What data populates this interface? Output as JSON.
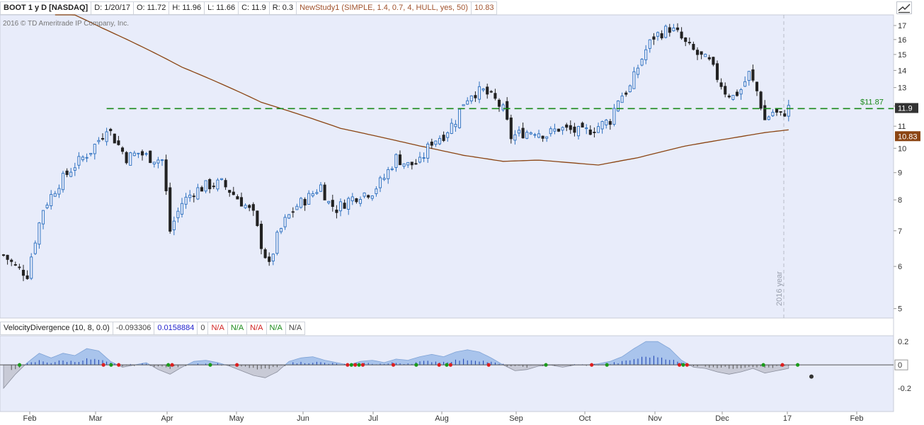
{
  "header": {
    "symbol": "BOOT 1 y D [NASDAQ]",
    "date": "D: 1/20/17",
    "open": "O: 11.72",
    "high": "H: 11.96",
    "low": "L: 11.66",
    "close": "C: 11.9",
    "range": "R: 0.3",
    "study": "NewStudy1 (SIMPLE, 1.4, 0.7, 4, HULL, yes, 50)",
    "study_value": "10.83"
  },
  "copyright": "2016 © TD Ameritrade IP Company, Inc.",
  "lower": {
    "name": "VelocityDivergence (10, 8, 0.0)",
    "v1": "-0.093306",
    "v2": "0.0158884",
    "v3": "0",
    "v4": "N/A",
    "v5": "N/A",
    "v6": "N/A",
    "v7": "N/A",
    "v8": "N/A"
  },
  "price_labels": {
    "hline": "$11.87",
    "last_close": "11.9",
    "ma_value": "10.83"
  },
  "year_label": "2016 year",
  "colors": {
    "up": "#2b6fbf",
    "down": "#222222",
    "ma": "#8b4513",
    "hline": "#1a8a1a",
    "bg_main": "#e8ecfa",
    "area": "#a9c4ec",
    "area_neg": "#c8cad6"
  },
  "chart_data": {
    "type": "candlestick",
    "scale": "log",
    "ylim": [
      4.8,
      17.8
    ],
    "y_ticks": [
      "17",
      "16",
      "15",
      "14",
      "13",
      "12",
      "11",
      "10",
      "9",
      "8",
      "7",
      "6",
      "5"
    ],
    "x_ticks": [
      "Feb",
      "Mar",
      "Apr",
      "May",
      "Jun",
      "Jul",
      "Aug",
      "Sep",
      "Oct",
      "Nov",
      "Dec",
      "17",
      "Feb"
    ],
    "hline": 11.87,
    "close_path": [
      [
        0,
        6.3
      ],
      [
        3,
        6.0
      ],
      [
        6,
        5.8
      ],
      [
        10,
        7.7
      ],
      [
        14,
        8.6
      ],
      [
        18,
        9.3
      ],
      [
        22,
        9.9
      ],
      [
        25,
        10.6
      ],
      [
        26,
        11.0
      ],
      [
        28,
        10.4
      ],
      [
        31,
        9.6
      ],
      [
        34,
        9.8
      ],
      [
        37,
        9.6
      ],
      [
        40,
        9.5
      ],
      [
        42,
        7.0
      ],
      [
        45,
        7.9
      ],
      [
        48,
        8.3
      ],
      [
        51,
        8.5
      ],
      [
        55,
        8.6
      ],
      [
        58,
        8.2
      ],
      [
        61,
        7.8
      ],
      [
        63,
        7.5
      ],
      [
        65,
        6.6
      ],
      [
        67,
        6.0
      ],
      [
        69,
        6.8
      ],
      [
        71,
        7.3
      ],
      [
        74,
        7.8
      ],
      [
        77,
        8.1
      ],
      [
        80,
        8.5
      ],
      [
        82,
        7.9
      ],
      [
        84,
        7.7
      ],
      [
        87,
        8.0
      ],
      [
        90,
        8.2
      ],
      [
        93,
        8.3
      ],
      [
        96,
        8.8
      ],
      [
        99,
        9.6
      ],
      [
        102,
        9.3
      ],
      [
        105,
        9.4
      ],
      [
        108,
        10.3
      ],
      [
        111,
        10.6
      ],
      [
        114,
        11.3
      ],
      [
        116,
        12.2
      ],
      [
        118,
        12.7
      ],
      [
        121,
        12.8
      ],
      [
        124,
        12.3
      ],
      [
        126,
        11.8
      ],
      [
        128,
        10.5
      ],
      [
        131,
        10.7
      ],
      [
        134,
        10.8
      ],
      [
        137,
        10.6
      ],
      [
        140,
        10.9
      ],
      [
        143,
        10.8
      ],
      [
        146,
        10.7
      ],
      [
        149,
        10.9
      ],
      [
        151,
        11.1
      ],
      [
        153,
        11.3
      ],
      [
        155,
        12.4
      ],
      [
        158,
        13.0
      ],
      [
        160,
        14.2
      ],
      [
        162,
        15.3
      ],
      [
        164,
        16.2
      ],
      [
        166,
        16.5
      ],
      [
        168,
        16.8
      ],
      [
        170,
        16.4
      ],
      [
        172,
        15.7
      ],
      [
        175,
        15.0
      ],
      [
        178,
        14.5
      ],
      [
        180,
        13.6
      ],
      [
        182,
        12.8
      ],
      [
        184,
        12.5
      ],
      [
        186,
        12.9
      ],
      [
        188,
        13.8
      ],
      [
        190,
        12.8
      ],
      [
        192,
        11.3
      ],
      [
        194,
        11.7
      ],
      [
        196,
        11.5
      ],
      [
        198,
        11.9
      ]
    ],
    "series": [
      {
        "name": "NewStudy1",
        "values": [
          [
            13,
            18.5
          ],
          [
            25,
            16.8
          ],
          [
            45,
            14.2
          ],
          [
            65,
            12.2
          ],
          [
            85,
            10.9
          ],
          [
            105,
            10.1
          ],
          [
            116,
            9.7
          ],
          [
            126,
            9.45
          ],
          [
            135,
            9.5
          ],
          [
            150,
            9.3
          ],
          [
            160,
            9.6
          ],
          [
            172,
            10.1
          ],
          [
            182,
            10.4
          ],
          [
            192,
            10.7
          ],
          [
            198,
            10.83
          ]
        ]
      },
      {
        "name": "VelocityDivergence",
        "ylim": [
          -0.4,
          0.25
        ],
        "y_ticks": [
          "0.2",
          "0",
          "-0.2"
        ],
        "values": [
          [
            0,
            -0.2
          ],
          [
            3,
            -0.08
          ],
          [
            6,
            0.02
          ],
          [
            9,
            0.1
          ],
          [
            12,
            0.06
          ],
          [
            15,
            0.1
          ],
          [
            18,
            0.08
          ],
          [
            21,
            0.14
          ],
          [
            24,
            0.12
          ],
          [
            27,
            0.03
          ],
          [
            30,
            -0.02
          ],
          [
            33,
            0.0
          ],
          [
            36,
            0.02
          ],
          [
            39,
            -0.04
          ],
          [
            42,
            -0.08
          ],
          [
            45,
            -0.02
          ],
          [
            48,
            0.03
          ],
          [
            51,
            0.04
          ],
          [
            54,
            0.02
          ],
          [
            57,
            -0.01
          ],
          [
            60,
            -0.05
          ],
          [
            63,
            -0.09
          ],
          [
            66,
            -0.11
          ],
          [
            69,
            -0.06
          ],
          [
            72,
            0.03
          ],
          [
            75,
            0.06
          ],
          [
            78,
            0.07
          ],
          [
            81,
            0.04
          ],
          [
            84,
            0.02
          ],
          [
            87,
            0.0
          ],
          [
            90,
            0.03
          ],
          [
            93,
            0.04
          ],
          [
            96,
            0.02
          ],
          [
            99,
            0.05
          ],
          [
            102,
            0.04
          ],
          [
            105,
            0.07
          ],
          [
            108,
            0.09
          ],
          [
            111,
            0.07
          ],
          [
            114,
            0.11
          ],
          [
            117,
            0.13
          ],
          [
            120,
            0.11
          ],
          [
            123,
            0.06
          ],
          [
            126,
            0.0
          ],
          [
            129,
            -0.05
          ],
          [
            132,
            -0.04
          ],
          [
            135,
            -0.01
          ],
          [
            138,
            0.0
          ],
          [
            141,
            -0.02
          ],
          [
            144,
            0.0
          ],
          [
            147,
            0.0
          ],
          [
            150,
            0.01
          ],
          [
            153,
            0.03
          ],
          [
            156,
            0.07
          ],
          [
            159,
            0.14
          ],
          [
            162,
            0.2
          ],
          [
            165,
            0.2
          ],
          [
            168,
            0.14
          ],
          [
            171,
            0.04
          ],
          [
            174,
            -0.02
          ],
          [
            177,
            -0.03
          ],
          [
            180,
            -0.06
          ],
          [
            183,
            -0.08
          ],
          [
            186,
            -0.06
          ],
          [
            189,
            -0.03
          ],
          [
            192,
            -0.07
          ],
          [
            195,
            -0.05
          ],
          [
            198,
            -0.03
          ]
        ]
      }
    ]
  }
}
